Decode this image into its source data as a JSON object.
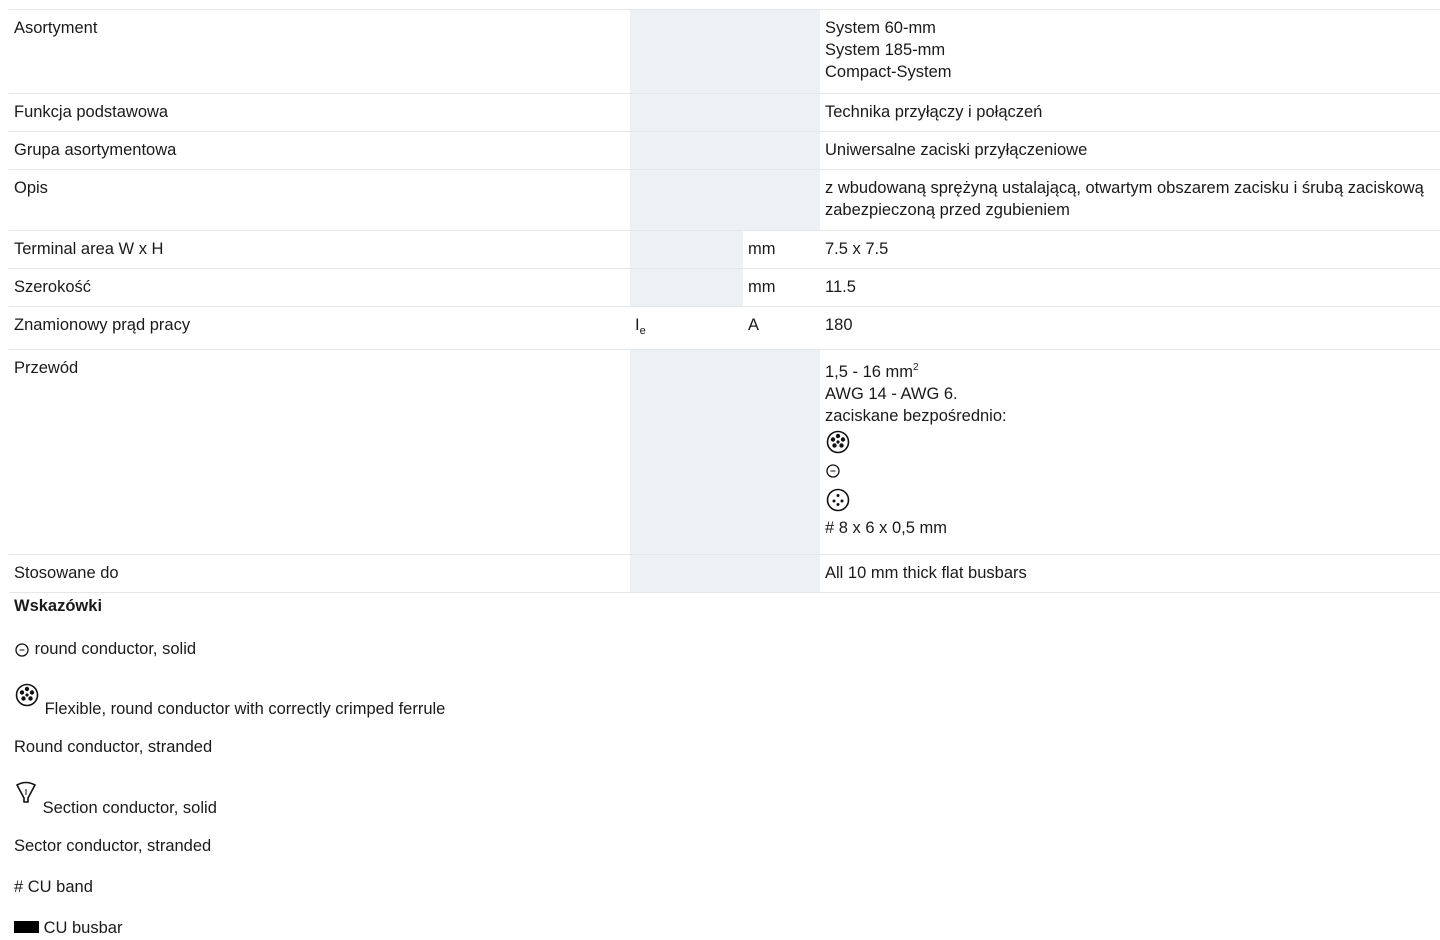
{
  "header": {
    "title": ""
  },
  "rows": [
    {
      "label": "Asortyment",
      "symbol": "",
      "unit": "",
      "values": [
        "System 60-mm",
        "System 185-mm",
        "Compact-System"
      ]
    },
    {
      "label": "Funkcja podstawowa",
      "symbol": "",
      "unit": "",
      "values": [
        "Technika przyłączy i połączeń"
      ]
    },
    {
      "label": "Grupa asortymentowa",
      "symbol": "",
      "unit": "",
      "values": [
        "Uniwersalne zaciski przyłączeniowe"
      ]
    },
    {
      "label": "Opis",
      "symbol": "",
      "unit": "",
      "values": [
        "z wbudowaną sprężyną ustalającą, otwartym obszarem zacisku i śrubą zaciskową zabezpieczoną przed zgubieniem"
      ]
    },
    {
      "label": "Terminal area W x H",
      "symbol": "",
      "unit": "mm",
      "values": [
        "7.5 x 7.5"
      ]
    },
    {
      "label": "Szerokość",
      "symbol": "",
      "unit": "mm",
      "values": [
        "11.5"
      ]
    },
    {
      "label": "Znamionowy prąd pracy",
      "symbol": "I",
      "symbol_sub": "e",
      "unit": "A",
      "values": [
        "180"
      ]
    },
    {
      "label": "Przewód",
      "symbol": "",
      "unit": "",
      "values": [
        "1,5 - 16 mm",
        "AWG 14 - AWG 6.",
        "zaciskane bezpośrednio:",
        "# 8 x 6 x 0,5 mm"
      ],
      "value_superscript": "2",
      "icons": [
        "flexible-ferrule-icon",
        "round-solid-icon",
        "round-stranded-icon"
      ]
    },
    {
      "label": "Stosowane do",
      "symbol": "",
      "unit": "",
      "values": [
        "All 10 mm thick flat busbars"
      ]
    }
  ],
  "notes": {
    "title": "Wskazówki",
    "items": [
      {
        "icon": "round-solid-icon",
        "text": "round conductor, solid"
      },
      {
        "icon": "flexible-ferrule-icon",
        "text": "Flexible, round conductor with correctly crimped ferrule"
      },
      {
        "icon": "",
        "text": "Round conductor, stranded"
      },
      {
        "icon": "sector-solid-icon",
        "text": "Section conductor, solid"
      },
      {
        "icon": "",
        "text": "Sector conductor, stranded"
      },
      {
        "icon": "",
        "text": "# CU band"
      },
      {
        "icon": "busbar-icon",
        "text": "CU busbar"
      }
    ]
  },
  "colors": {
    "shaded_column": "#eef1f4",
    "row_border": "#e3e7ea",
    "text": "#1a1a1a",
    "heading": "#1a64b4"
  }
}
